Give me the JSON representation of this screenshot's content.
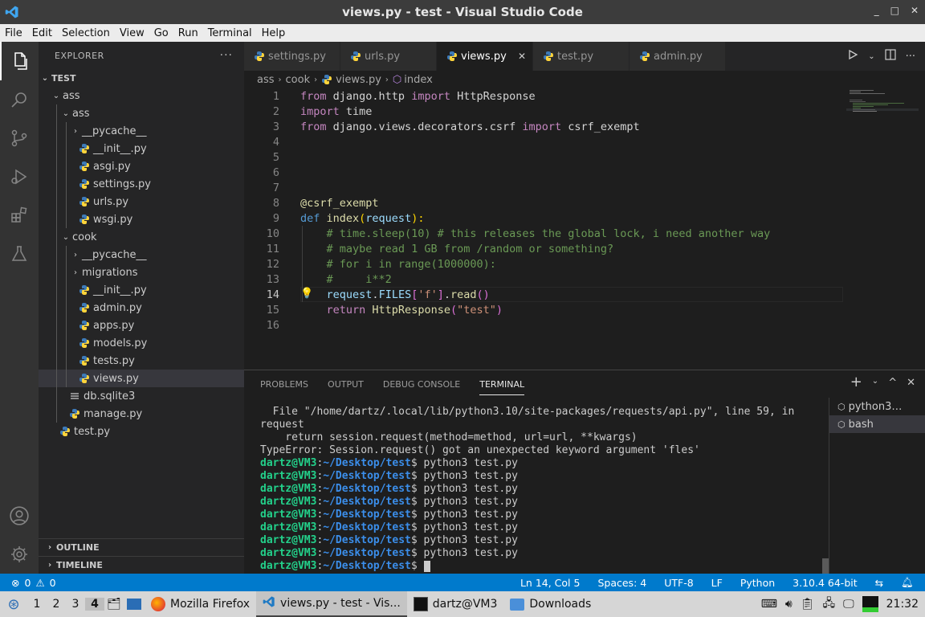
{
  "window": {
    "title": "views.py - test - Visual Studio Code",
    "minimize": "_",
    "maximize": "□",
    "close": "✕"
  },
  "menu": [
    "File",
    "Edit",
    "Selection",
    "View",
    "Go",
    "Run",
    "Terminal",
    "Help"
  ],
  "explorer": {
    "title": "EXPLORER",
    "more": "···",
    "root": "TEST",
    "tree": [
      {
        "label": "ass",
        "type": "folder",
        "open": true,
        "indent": 1
      },
      {
        "label": "ass",
        "type": "folder",
        "open": true,
        "indent": 2
      },
      {
        "label": "__pycache__",
        "type": "folder",
        "open": false,
        "indent": 3
      },
      {
        "label": "__init__.py",
        "type": "py",
        "indent": 3
      },
      {
        "label": "asgi.py",
        "type": "py",
        "indent": 3
      },
      {
        "label": "settings.py",
        "type": "py",
        "indent": 3
      },
      {
        "label": "urls.py",
        "type": "py",
        "indent": 3
      },
      {
        "label": "wsgi.py",
        "type": "py",
        "indent": 3
      },
      {
        "label": "cook",
        "type": "folder",
        "open": true,
        "indent": 2
      },
      {
        "label": "__pycache__",
        "type": "folder",
        "open": false,
        "indent": 3
      },
      {
        "label": "migrations",
        "type": "folder",
        "open": false,
        "indent": 3
      },
      {
        "label": "__init__.py",
        "type": "py",
        "indent": 3
      },
      {
        "label": "admin.py",
        "type": "py",
        "indent": 3
      },
      {
        "label": "apps.py",
        "type": "py",
        "indent": 3
      },
      {
        "label": "models.py",
        "type": "py",
        "indent": 3
      },
      {
        "label": "tests.py",
        "type": "py",
        "indent": 3
      },
      {
        "label": "views.py",
        "type": "py",
        "indent": 3,
        "selected": true
      },
      {
        "label": "db.sqlite3",
        "type": "db",
        "indent": 2
      },
      {
        "label": "manage.py",
        "type": "py",
        "indent": 2
      },
      {
        "label": "test.py",
        "type": "py",
        "indent": 1
      }
    ],
    "outline": "OUTLINE",
    "timeline": "TIMELINE"
  },
  "tabs": [
    {
      "label": "settings.py"
    },
    {
      "label": "urls.py"
    },
    {
      "label": "views.py",
      "active": true
    },
    {
      "label": "test.py"
    },
    {
      "label": "admin.py"
    }
  ],
  "breadcrumb": {
    "a": "ass",
    "b": "cook",
    "c": "views.py",
    "d": "index"
  },
  "editor": {
    "current_line": 14,
    "lines": [
      [
        [
          "kw",
          "from "
        ],
        [
          "pl",
          "django.http "
        ],
        [
          "kw",
          "import "
        ],
        [
          "pl",
          "HttpResponse"
        ]
      ],
      [
        [
          "kw",
          "import "
        ],
        [
          "pl",
          "time"
        ]
      ],
      [
        [
          "kw",
          "from "
        ],
        [
          "pl",
          "django.views.decorators.csrf "
        ],
        [
          "kw",
          "import "
        ],
        [
          "pl",
          "csrf_exempt"
        ]
      ],
      [],
      [],
      [],
      [],
      [
        [
          "fn",
          "@csrf_exempt"
        ]
      ],
      [
        [
          "bl",
          "def "
        ],
        [
          "fn",
          "index"
        ],
        [
          "br",
          "("
        ],
        [
          "var",
          "request"
        ],
        [
          "br",
          "):"
        ]
      ],
      [
        [
          "pl",
          "    "
        ],
        [
          "cm",
          "# time.sleep(10) # this releases the global lock, i need another way"
        ]
      ],
      [
        [
          "pl",
          "    "
        ],
        [
          "cm",
          "# maybe read 1 GB from /random or something?"
        ]
      ],
      [
        [
          "pl",
          "    "
        ],
        [
          "cm",
          "# for i in range(1000000):"
        ]
      ],
      [
        [
          "pl",
          "    "
        ],
        [
          "cm",
          "#     i**2"
        ]
      ],
      [
        [
          "pl",
          "    "
        ],
        [
          "var",
          "request"
        ],
        [
          "pl",
          "."
        ],
        [
          "var",
          "FILES"
        ],
        [
          "br2",
          "["
        ],
        [
          "str",
          "'f'"
        ],
        [
          "br2",
          "]"
        ],
        [
          "pl",
          "."
        ],
        [
          "fn",
          "read"
        ],
        [
          "br2",
          "()"
        ]
      ],
      [
        [
          "pl",
          "    "
        ],
        [
          "kw",
          "return "
        ],
        [
          "fn",
          "HttpResponse"
        ],
        [
          "br2",
          "("
        ],
        [
          "str",
          "\"test\""
        ],
        [
          "br2",
          ")"
        ]
      ],
      []
    ]
  },
  "panel": {
    "tabs": [
      "PROBLEMS",
      "OUTPUT",
      "DEBUG CONSOLE",
      "TERMINAL"
    ],
    "active": "TERMINAL",
    "terminal_lines": [
      "  File \"/home/dartz/.local/lib/python3.10/site-packages/requests/api.py\", line 59, in",
      "request",
      "    return session.request(method=method, url=url, **kwargs)",
      "TypeError: Session.request() got an unexpected keyword argument 'fles'"
    ],
    "prompt_user": "dartz@VM3",
    "prompt_path": "~/Desktop/test",
    "prompt_cmd": "python3 test.py",
    "prompt_count": 8,
    "terminals": [
      "python3…",
      "bash"
    ]
  },
  "status": {
    "errors": "0",
    "warnings": "0",
    "position": "Ln 14, Col 5",
    "spaces": "Spaces: 4",
    "encoding": "UTF-8",
    "eol": "LF",
    "language": "Python",
    "interpreter": "3.10.4 64-bit"
  },
  "taskbar": {
    "workspaces": [
      "1",
      "2",
      "3",
      "4"
    ],
    "active_ws": "4",
    "firefox": "Mozilla Firefox",
    "vscode": "views.py - test - Vis...",
    "terminal": "dartz@VM3",
    "downloads": "Downloads",
    "clock": "21:32"
  }
}
